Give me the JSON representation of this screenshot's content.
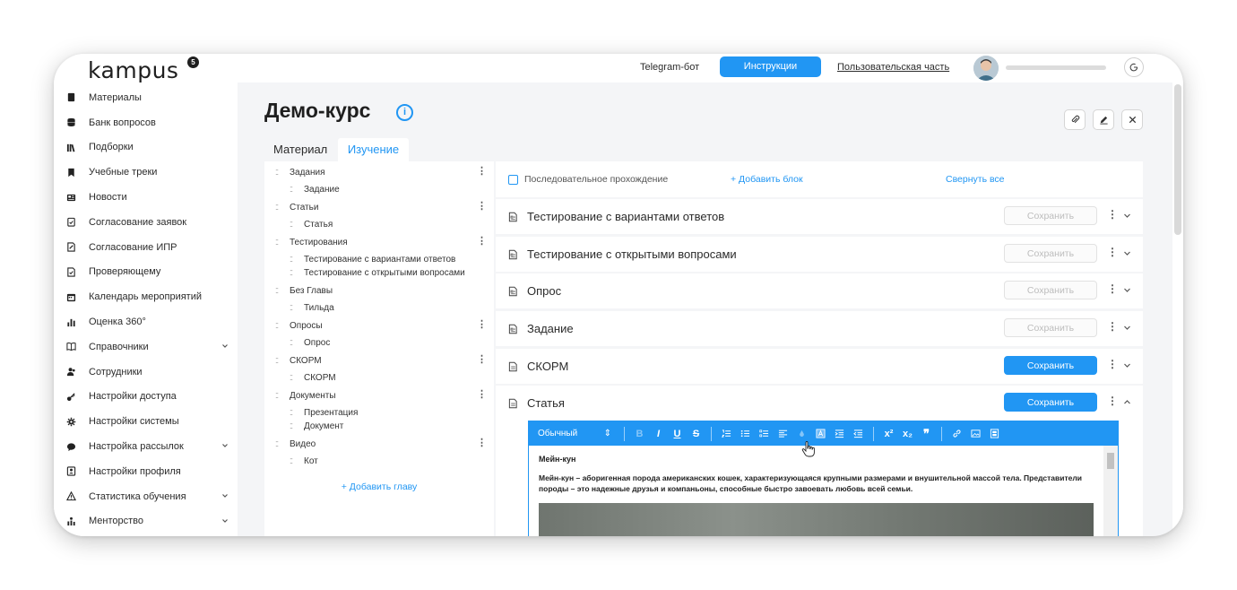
{
  "app": {
    "logo": "kampus",
    "logo_badge": "5"
  },
  "topbar": {
    "telegram_label": "Telegram-бот",
    "instructions_label": "Инструкции",
    "user_part_label": "Пользовательская часть"
  },
  "sidebar": {
    "items": [
      {
        "label": "Материалы",
        "icon": "book-icon",
        "chevron": false
      },
      {
        "label": "Банк вопросов",
        "icon": "database-icon",
        "chevron": false
      },
      {
        "label": "Подборки",
        "icon": "library-icon",
        "chevron": false
      },
      {
        "label": "Учебные треки",
        "icon": "bookmark-icon",
        "chevron": false
      },
      {
        "label": "Новости",
        "icon": "news-icon",
        "chevron": false
      },
      {
        "label": "Согласование заявок",
        "icon": "clipboard-check-icon",
        "chevron": false
      },
      {
        "label": "Согласование ИПР",
        "icon": "document-edit-icon",
        "chevron": false
      },
      {
        "label": "Проверяющему",
        "icon": "document-check-icon",
        "chevron": false
      },
      {
        "label": "Календарь мероприятий",
        "icon": "calendar-icon",
        "chevron": false
      },
      {
        "label": "Оценка 360°",
        "icon": "bar-chart-icon",
        "chevron": false
      },
      {
        "label": "Справочники",
        "icon": "open-book-icon",
        "chevron": true
      },
      {
        "label": "Сотрудники",
        "icon": "users-icon",
        "chevron": false
      },
      {
        "label": "Настройки доступа",
        "icon": "key-icon",
        "chevron": false
      },
      {
        "label": "Настройки системы",
        "icon": "gear-icon",
        "chevron": false
      },
      {
        "label": "Настройка рассылок",
        "icon": "chat-bubble-icon",
        "chevron": true
      },
      {
        "label": "Настройки профиля",
        "icon": "profile-card-icon",
        "chevron": false
      },
      {
        "label": "Статистика обучения",
        "icon": "warning-icon",
        "chevron": true
      },
      {
        "label": "Менторство",
        "icon": "team-chart-icon",
        "chevron": true
      }
    ]
  },
  "page": {
    "title": "Демо-курс",
    "info_icon": "i",
    "tabs": [
      "Материал",
      "Изучение"
    ]
  },
  "outline": {
    "rows": [
      {
        "text": "Задания",
        "level": 0,
        "menu": true
      },
      {
        "text": "Задание",
        "level": 1,
        "menu": false
      },
      {
        "text": "Статьи",
        "level": 0,
        "menu": true
      },
      {
        "text": "Статья",
        "level": 1,
        "menu": false
      },
      {
        "text": "Тестирования",
        "level": 0,
        "menu": true
      },
      {
        "text": "Тестирование с вариантами ответов",
        "level": 1,
        "menu": false
      },
      {
        "text": "Тестирование с открытыми вопросами",
        "level": 1,
        "menu": false
      },
      {
        "text": "Без Главы",
        "level": 0,
        "menu": false
      },
      {
        "text": "Тильда",
        "level": 1,
        "menu": false
      },
      {
        "text": "Опросы",
        "level": 0,
        "menu": true
      },
      {
        "text": "Опрос",
        "level": 1,
        "menu": false
      },
      {
        "text": "СКОРМ",
        "level": 0,
        "menu": true
      },
      {
        "text": "СКОРМ",
        "level": 1,
        "menu": false
      },
      {
        "text": "Документы",
        "level": 0,
        "menu": true
      },
      {
        "text": "Презентация",
        "level": 1,
        "menu": false
      },
      {
        "text": "Документ",
        "level": 1,
        "menu": false
      },
      {
        "text": "Видео",
        "level": 0,
        "menu": true
      },
      {
        "text": "Кот",
        "level": 1,
        "menu": false
      }
    ],
    "add_chapter": "+ Добавить главу"
  },
  "content": {
    "sequential_label": "Последовательное прохождение",
    "add_block": "+ Добавить блок",
    "collapse_all": "Свернуть все",
    "save_label": "Сохранить",
    "blocks": [
      {
        "title": "Тестирование с вариантами ответов",
        "save_active": false,
        "expanded": false
      },
      {
        "title": "Тестирование с открытыми вопросами",
        "save_active": false,
        "expanded": false
      },
      {
        "title": "Опрос",
        "save_active": false,
        "expanded": false
      },
      {
        "title": "Задание",
        "save_active": false,
        "expanded": false
      },
      {
        "title": "СКОРМ",
        "save_active": true,
        "expanded": false
      },
      {
        "title": "Статья",
        "save_active": true,
        "expanded": true
      }
    ]
  },
  "editor": {
    "format_select": "Обычный",
    "heading": "Мейн-кун",
    "paragraph": "Мейн-кун – аборигенная порода американских кошек, характеризующаяся крупными размерами и внушительной массой тела. Представители породы – это надежные друзья и компаньоны, способные быстро завоевать любовь всей семьи.",
    "toolbar_glyphs": {
      "bold": "B",
      "italic": "I",
      "underline": "U",
      "strike": "S",
      "superscript": "x²",
      "subscript": "x₂",
      "quote": "❞"
    }
  },
  "colors": {
    "accent": "#2196f3",
    "text": "#2b2b2b",
    "panel_bg": "#f4f5f7"
  }
}
